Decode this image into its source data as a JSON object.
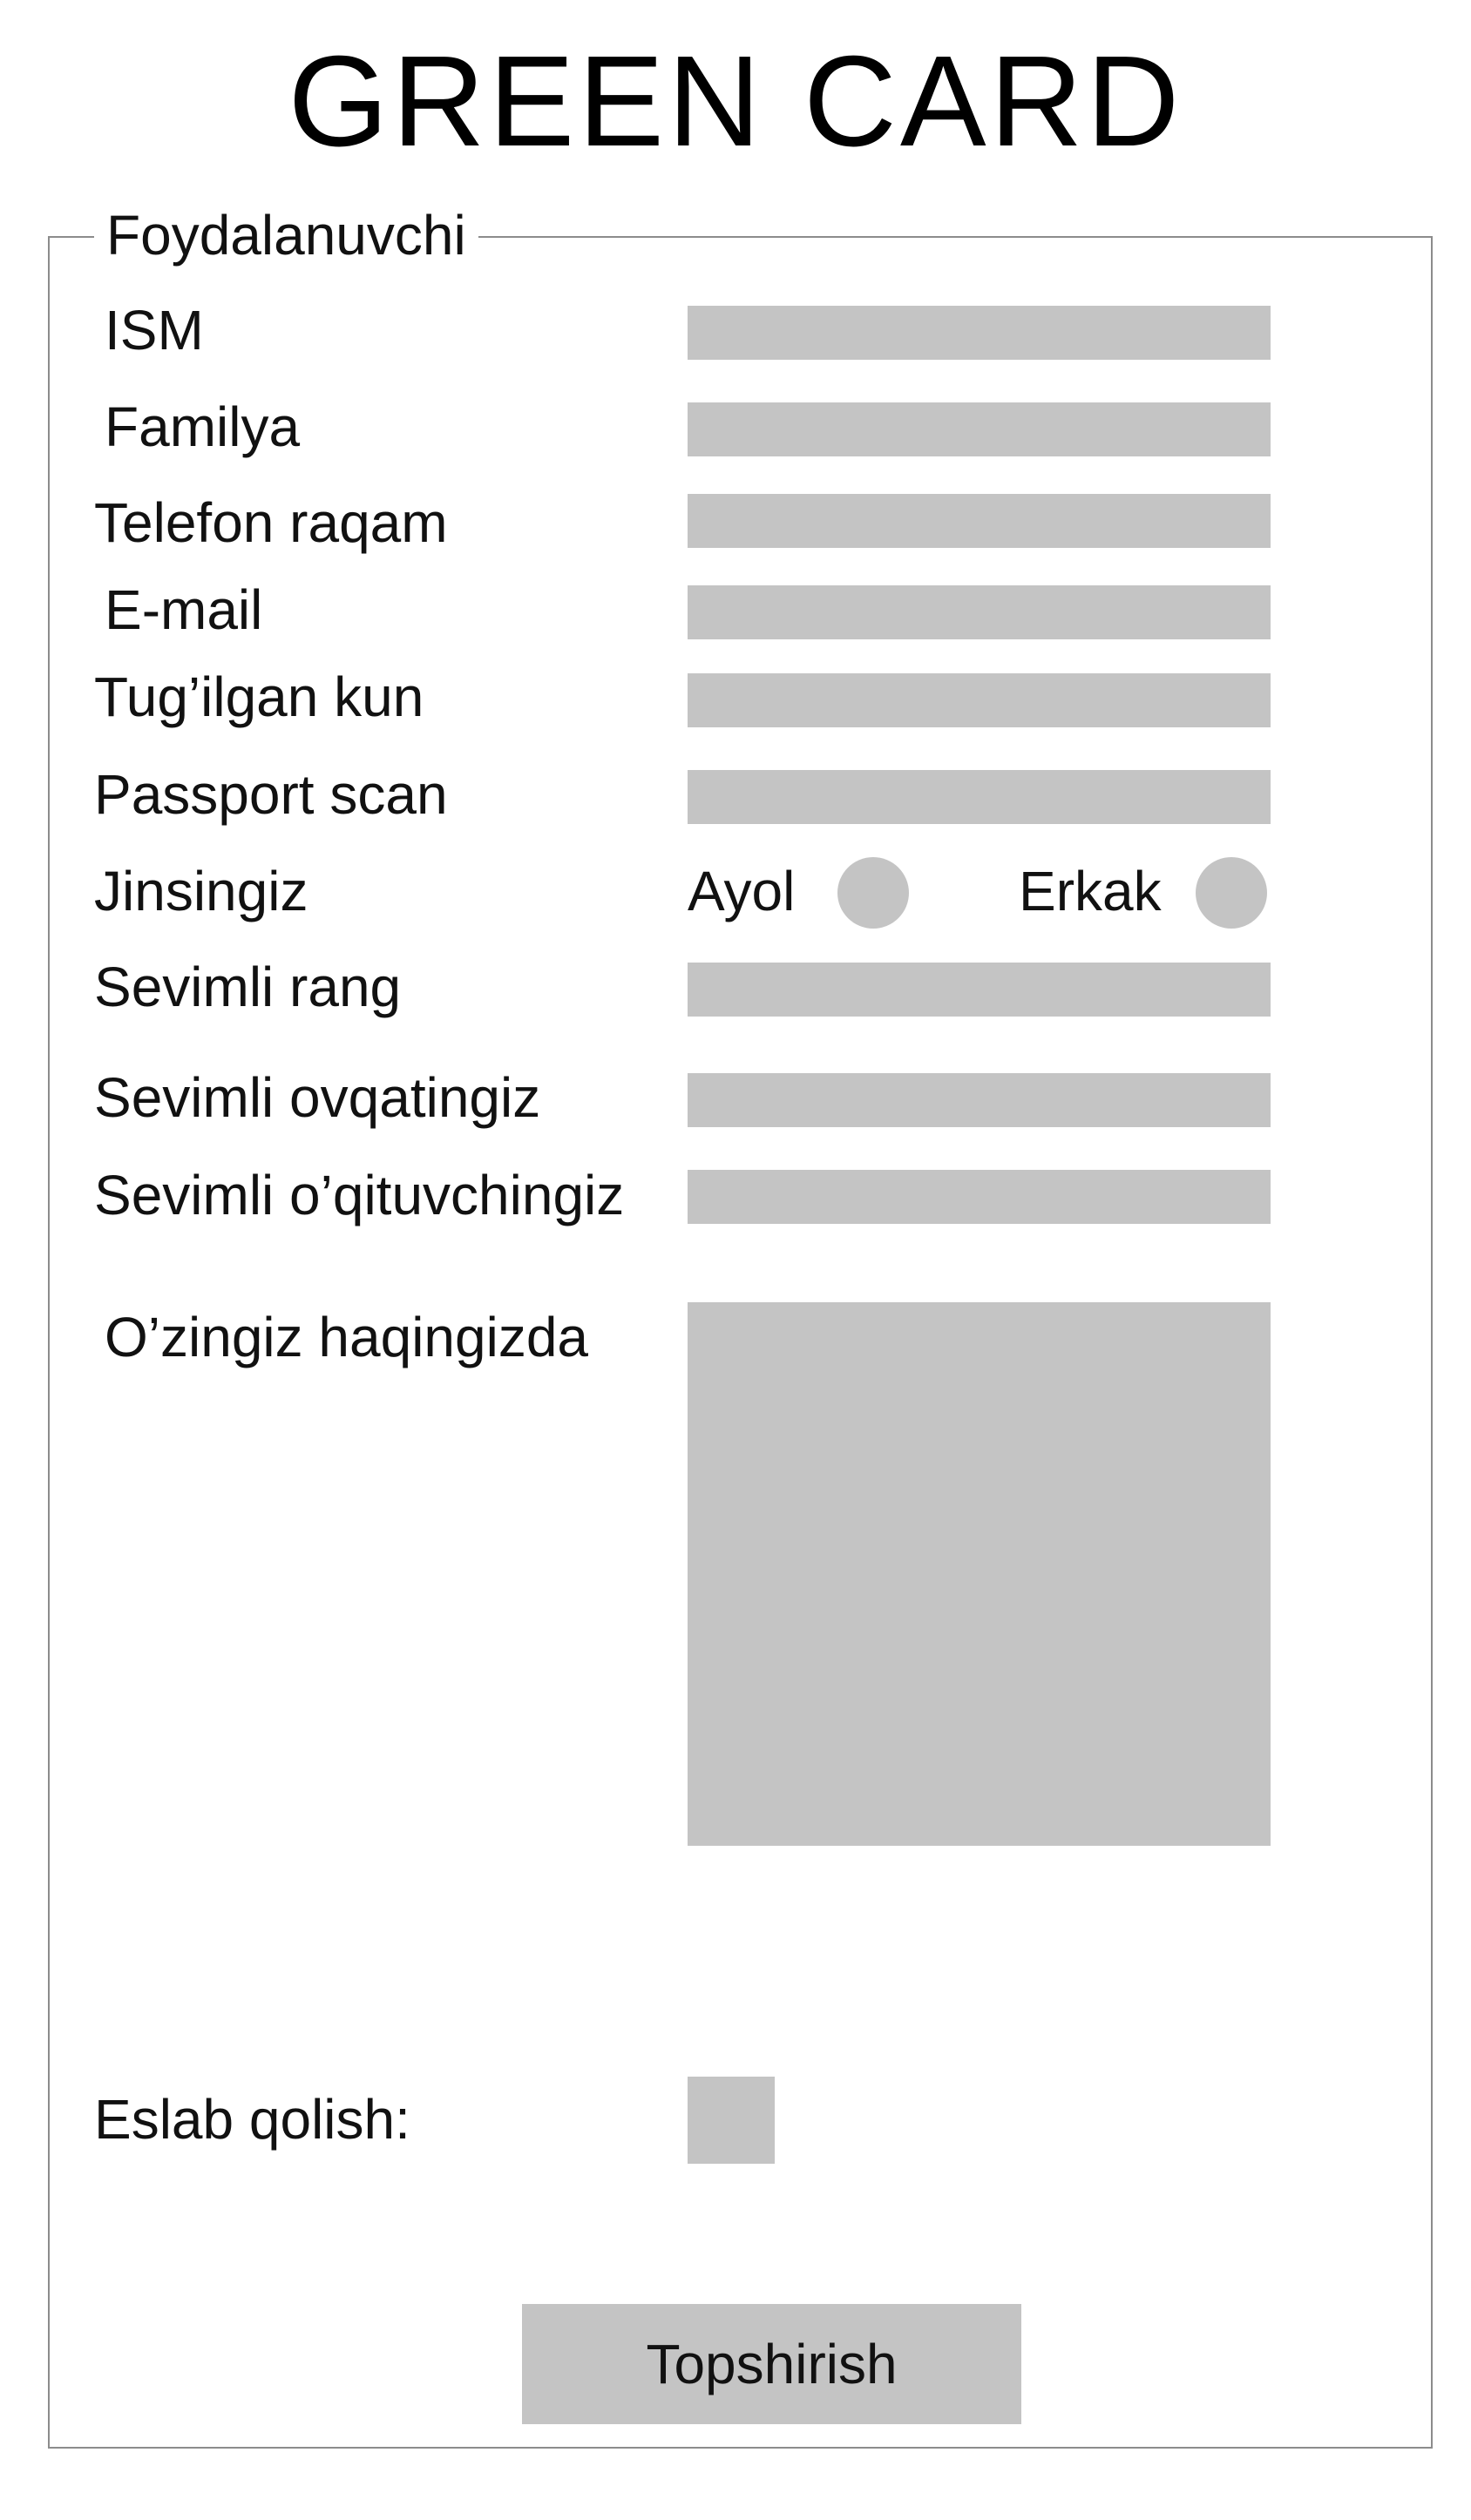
{
  "page": {
    "title": "GREEN CARD"
  },
  "form": {
    "legend": "Foydalanuvchi",
    "fields": {
      "ism": {
        "label": "ISM",
        "value": ""
      },
      "familya": {
        "label": "Familya",
        "value": ""
      },
      "telefon": {
        "label": "Telefon raqam",
        "value": ""
      },
      "email": {
        "label": "E-mail",
        "value": ""
      },
      "tugilgan_kun": {
        "label": "Tug’ilgan kun",
        "value": ""
      },
      "passport": {
        "label": "Passport scan",
        "value": ""
      },
      "sevimli_rang": {
        "label": "Sevimli rang",
        "value": ""
      },
      "sevimli_ovqat": {
        "label": "Sevimli ovqatingiz",
        "value": ""
      },
      "sevimli_oqituvchi": {
        "label": "Sevimli o’qituvchingiz",
        "value": ""
      },
      "ozingiz": {
        "label": "O’zingiz haqingizda",
        "value": ""
      }
    },
    "gender": {
      "label": "Jinsingiz",
      "options": [
        "Ayol",
        "Erkak"
      ]
    },
    "remember": {
      "label": "Eslab qolish:"
    },
    "submit_label": "Topshirish"
  },
  "colors": {
    "field_fill": "#c4c4c4",
    "border": "#8c8c8c",
    "text": "#111111"
  }
}
